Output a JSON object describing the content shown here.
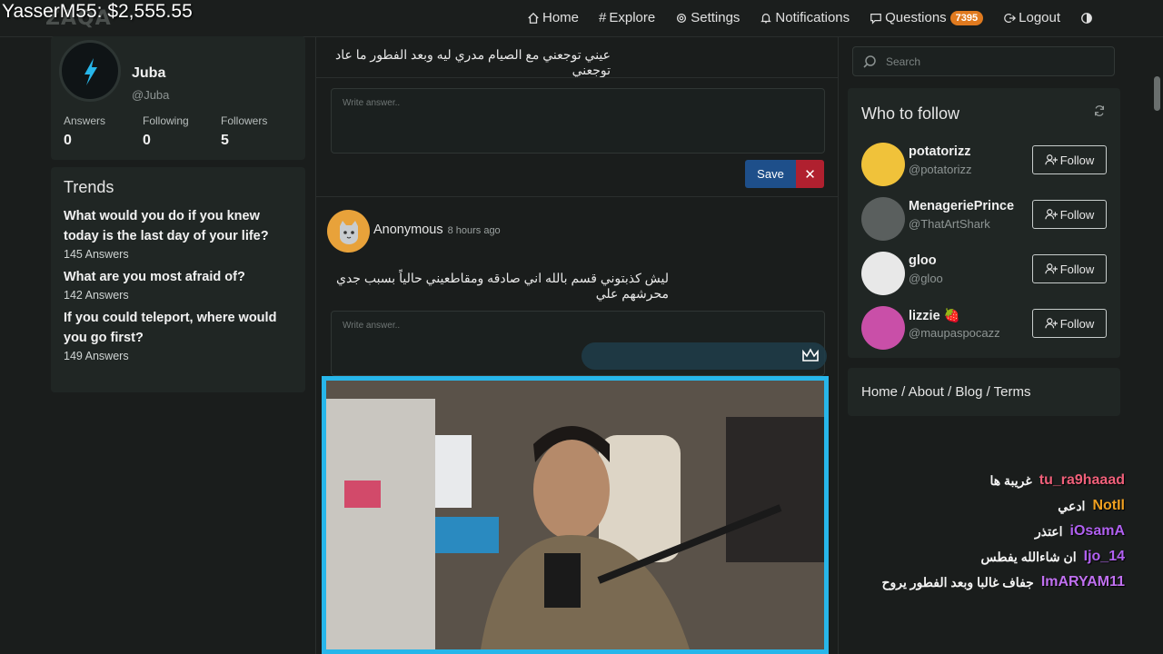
{
  "overlay": {
    "title": "YasserM55: $2,555.55"
  },
  "brand": {
    "name": "ZAQA"
  },
  "nav": {
    "home": "Home",
    "explore": "Explore",
    "settings": "Settings",
    "notifications": "Notifications",
    "questions": "Questions",
    "questions_count": "7395",
    "logout": "Logout"
  },
  "profile": {
    "name": "Juba",
    "handle": "@Juba",
    "stats": [
      {
        "label": "Answers",
        "value": "0"
      },
      {
        "label": "Following",
        "value": "0"
      },
      {
        "label": "Followers",
        "value": "5"
      }
    ]
  },
  "trends": {
    "title": "Trends",
    "items": [
      {
        "question": "What would you do if you knew today is the last day of your life?",
        "count": "145 Answers"
      },
      {
        "question": "What are you most afraid of?",
        "count": "142 Answers"
      },
      {
        "question": "If you could teleport, where would you go first?",
        "count": "149 Answers"
      }
    ]
  },
  "feed": {
    "question1": "عيني توجعني مع الصيام مدري ليه وبعد الفطور ما عاد توجعني",
    "answer_placeholder": "Write answer..",
    "save_label": "Save",
    "close_label": "✕",
    "post2": {
      "author": "Anonymous",
      "time": "8 hours ago",
      "question": "ليش كذبتوني قسم بالله اني صادقه ومقاطعيني حالياً بسبب جدي محرشهم علي"
    }
  },
  "search": {
    "placeholder": "Search"
  },
  "who_to_follow": {
    "title": "Who to follow",
    "follow_label": "Follow",
    "users": [
      {
        "name": "potatorizz",
        "handle": "@potatorizz",
        "color": "#f0c23a"
      },
      {
        "name": "MenageriePrince",
        "handle": "@ThatArtShark",
        "color": "#5a5f5e"
      },
      {
        "name": "gloo",
        "handle": "@gloo",
        "color": "#e8e8e8"
      },
      {
        "name": "lizzie 🍓",
        "handle": "@maupaspocazz",
        "color": "#c94fa8"
      }
    ]
  },
  "footer_links": {
    "text": "Home / About / Blog / Terms"
  },
  "chat": [
    {
      "user": "tu_ra9haaad",
      "msg": "غريبة ها",
      "color": "#f0607a"
    },
    {
      "user": "NotIl",
      "msg": "ادعي",
      "color": "#f0a020"
    },
    {
      "user": "iOsamA",
      "msg": "اعتذر",
      "color": "#b060f0"
    },
    {
      "user": "Ijo_14",
      "msg": "ان شاءالله يفطس",
      "color": "#b060f0"
    },
    {
      "user": "ImARYAM11",
      "msg": "جفاف غالبا وبعد الفطور يروح",
      "color": "#c070f0"
    }
  ]
}
